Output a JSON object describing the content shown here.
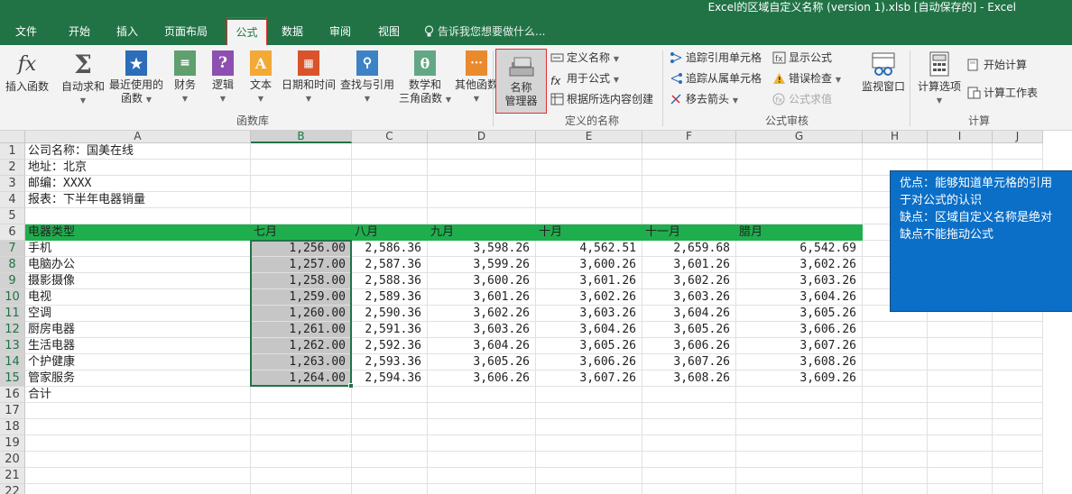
{
  "title": "Excel的区域自定义名称 (version 1).xlsb [自动保存的] - Excel",
  "tabs": [
    "文件",
    "开始",
    "插入",
    "页面布局",
    "公式",
    "数据",
    "审阅",
    "视图"
  ],
  "active_tab": "公式",
  "tell_me": "告诉我您想要做什么...",
  "ribbon": {
    "function_library": {
      "label": "函数库",
      "insert_function": "插入函数",
      "autosum": "自动求和",
      "recent_1": "最近使用的",
      "recent_2": "函数",
      "financial": "财务",
      "logical": "逻辑",
      "text": "文本",
      "datetime": "日期和时间",
      "lookup": "查找与引用",
      "math_1": "数学和",
      "math_2": "三角函数",
      "more": "其他函数"
    },
    "defined_names": {
      "label": "定义的名称",
      "name_manager_1": "名称",
      "name_manager_2": "管理器",
      "define_name": "定义名称",
      "use_in_formula": "用于公式",
      "create_from_selection": "根据所选内容创建"
    },
    "formula_auditing": {
      "label": "公式审核",
      "trace_precedents": "追踪引用单元格",
      "trace_dependents": "追踪从属单元格",
      "remove_arrows": "移去箭头",
      "show_formulas": "显示公式",
      "error_checking": "错误检查",
      "evaluate_formula": "公式求值",
      "watch_window": "监视窗口"
    },
    "calculation": {
      "label": "计算",
      "calc_options": "计算选项",
      "calc_now": "开始计算",
      "calc_sheet": "计算工作表"
    }
  },
  "sheet": {
    "columns": [
      "A",
      "B",
      "C",
      "D",
      "E",
      "F",
      "G",
      "H",
      "I",
      "J"
    ],
    "row_numbers": [
      "1",
      "2",
      "3",
      "4",
      "5",
      "6",
      "7",
      "8",
      "9",
      "10",
      "11",
      "12",
      "13",
      "14",
      "15",
      "16",
      "17",
      "18",
      "19",
      "20",
      "21",
      "22"
    ],
    "info": [
      "公司名称：国美在线",
      "地址：北京",
      "邮编：XXXX",
      "报表：下半年电器销量"
    ],
    "header": [
      "电器类型",
      "七月",
      "八月",
      "九月",
      "十月",
      "十一月",
      "腊月"
    ],
    "rows": [
      [
        "手机",
        "1,256.00",
        "2,586.36",
        "3,598.26",
        "4,562.51",
        "2,659.68",
        "6,542.69"
      ],
      [
        "电脑办公",
        "1,257.00",
        "2,587.36",
        "3,599.26",
        "3,600.26",
        "3,601.26",
        "3,602.26"
      ],
      [
        "摄影摄像",
        "1,258.00",
        "2,588.36",
        "3,600.26",
        "3,601.26",
        "3,602.26",
        "3,603.26"
      ],
      [
        "电视",
        "1,259.00",
        "2,589.36",
        "3,601.26",
        "3,602.26",
        "3,603.26",
        "3,604.26"
      ],
      [
        "空调",
        "1,260.00",
        "2,590.36",
        "3,602.26",
        "3,603.26",
        "3,604.26",
        "3,605.26"
      ],
      [
        "厨房电器",
        "1,261.00",
        "2,591.36",
        "3,603.26",
        "3,604.26",
        "3,605.26",
        "3,606.26"
      ],
      [
        "生活电器",
        "1,262.00",
        "2,592.36",
        "3,604.26",
        "3,605.26",
        "3,606.26",
        "3,607.26"
      ],
      [
        "个护健康",
        "1,263.00",
        "2,593.36",
        "3,605.26",
        "3,606.26",
        "3,607.26",
        "3,608.26"
      ],
      [
        "管家服务",
        "1,264.00",
        "2,594.36",
        "3,606.26",
        "3,607.26",
        "3,608.26",
        "3,609.26"
      ]
    ],
    "total_label": "合计"
  },
  "note": [
    "优点：能够知道单元格的引用",
    "于对公式的认识",
    "缺点：区域自定义名称是绝对",
    "缺点不能拖动公式"
  ],
  "colors": {
    "excel_green": "#217346",
    "header_fill": "#1fae4d",
    "note_fill": "#0b6fc7",
    "highlight_red": "#e0302f"
  }
}
